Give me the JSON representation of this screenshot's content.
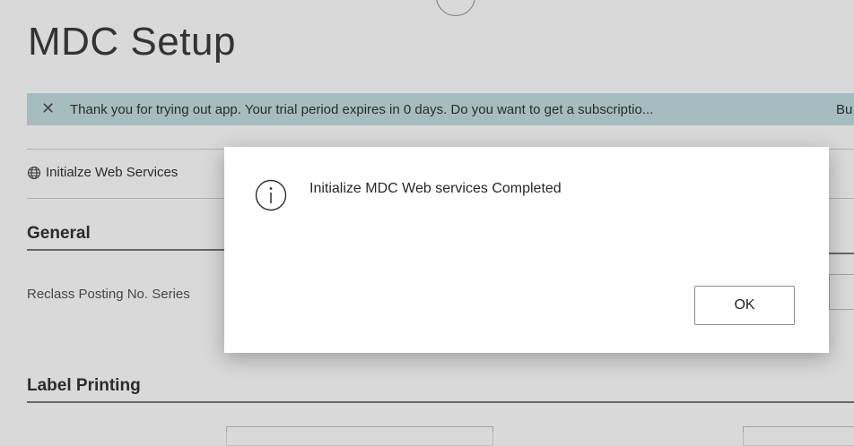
{
  "page": {
    "title": "MDC Setup"
  },
  "banner": {
    "close_icon": "close-icon",
    "message": "Thank you for trying out app. Your trial period expires in 0 days. Do you want to get a subscriptio...",
    "link": "Bu"
  },
  "actions": {
    "initialize_web_services": {
      "icon": "globe-icon",
      "label": "Initialze Web Services"
    }
  },
  "sections": {
    "general": {
      "title": "General",
      "fields": {
        "reclass_posting_no_series": {
          "label": "Reclass Posting No. Series"
        }
      }
    },
    "label_printing": {
      "title": "Label Printing"
    }
  },
  "dialog": {
    "icon": "info-icon",
    "message": "Initialize MDC Web services Completed",
    "ok_label": "OK"
  }
}
